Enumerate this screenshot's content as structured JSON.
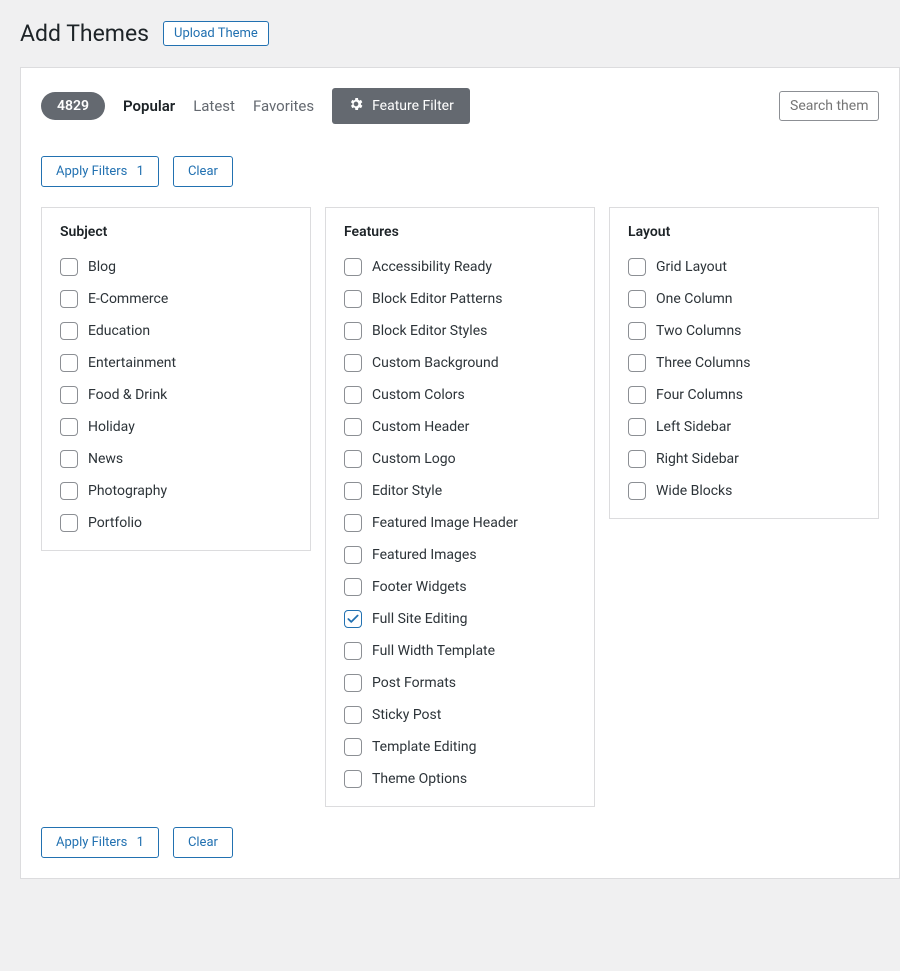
{
  "header": {
    "title": "Add Themes",
    "upload_label": "Upload Theme"
  },
  "nav": {
    "count": "4829",
    "links": [
      {
        "label": "Popular",
        "current": true
      },
      {
        "label": "Latest",
        "current": false
      },
      {
        "label": "Favorites",
        "current": false
      }
    ],
    "feature_filter_label": "Feature Filter",
    "search_placeholder": "Search them"
  },
  "actions": {
    "apply_label": "Apply Filters",
    "apply_count": "1",
    "clear_label": "Clear"
  },
  "filters": {
    "subject": {
      "title": "Subject",
      "items": [
        {
          "label": "Blog",
          "checked": false
        },
        {
          "label": "E-Commerce",
          "checked": false
        },
        {
          "label": "Education",
          "checked": false
        },
        {
          "label": "Entertainment",
          "checked": false
        },
        {
          "label": "Food & Drink",
          "checked": false
        },
        {
          "label": "Holiday",
          "checked": false
        },
        {
          "label": "News",
          "checked": false
        },
        {
          "label": "Photography",
          "checked": false
        },
        {
          "label": "Portfolio",
          "checked": false
        }
      ]
    },
    "features": {
      "title": "Features",
      "items": [
        {
          "label": "Accessibility Ready",
          "checked": false
        },
        {
          "label": "Block Editor Patterns",
          "checked": false
        },
        {
          "label": "Block Editor Styles",
          "checked": false
        },
        {
          "label": "Custom Background",
          "checked": false
        },
        {
          "label": "Custom Colors",
          "checked": false
        },
        {
          "label": "Custom Header",
          "checked": false
        },
        {
          "label": "Custom Logo",
          "checked": false
        },
        {
          "label": "Editor Style",
          "checked": false
        },
        {
          "label": "Featured Image Header",
          "checked": false
        },
        {
          "label": "Featured Images",
          "checked": false
        },
        {
          "label": "Footer Widgets",
          "checked": false
        },
        {
          "label": "Full Site Editing",
          "checked": true
        },
        {
          "label": "Full Width Template",
          "checked": false
        },
        {
          "label": "Post Formats",
          "checked": false
        },
        {
          "label": "Sticky Post",
          "checked": false
        },
        {
          "label": "Template Editing",
          "checked": false
        },
        {
          "label": "Theme Options",
          "checked": false
        }
      ]
    },
    "layout": {
      "title": "Layout",
      "items": [
        {
          "label": "Grid Layout",
          "checked": false
        },
        {
          "label": "One Column",
          "checked": false
        },
        {
          "label": "Two Columns",
          "checked": false
        },
        {
          "label": "Three Columns",
          "checked": false
        },
        {
          "label": "Four Columns",
          "checked": false
        },
        {
          "label": "Left Sidebar",
          "checked": false
        },
        {
          "label": "Right Sidebar",
          "checked": false
        },
        {
          "label": "Wide Blocks",
          "checked": false
        }
      ]
    }
  }
}
